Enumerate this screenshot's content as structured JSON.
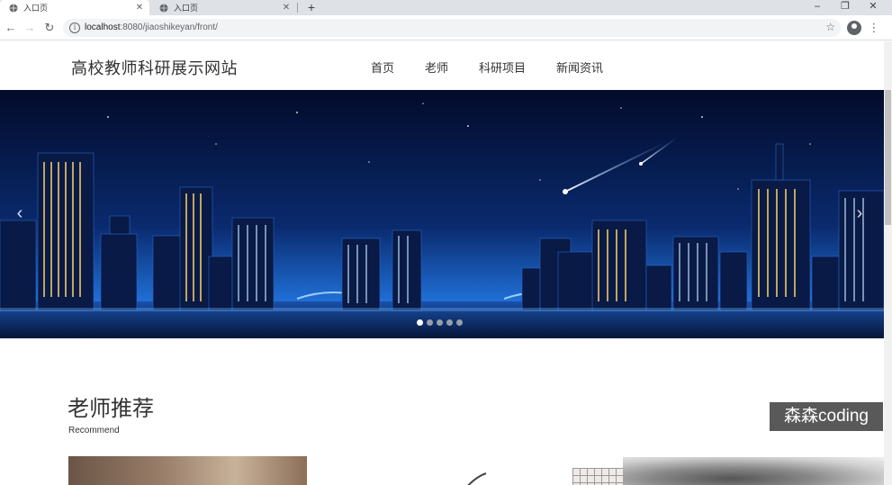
{
  "browser": {
    "tabs": [
      {
        "title": "入口页",
        "active": true
      },
      {
        "title": "入口页",
        "active": false
      }
    ],
    "new_tab_label": "+",
    "url_host": "localhost",
    "url_rest": ":8080/jiaoshikeyan/front/",
    "window_controls": [
      "–",
      "❐",
      "✕"
    ]
  },
  "site": {
    "brand": "高校教师科研展示网站",
    "nav": [
      "首页",
      "老师",
      "科研项目",
      "新闻资讯"
    ]
  },
  "carousel": {
    "prev_arrow": "‹",
    "next_arrow": "›",
    "slide_count": 5,
    "active_slide": 1
  },
  "recommend": {
    "title": "老师推荐",
    "subtitle": "Recommend"
  },
  "watermark": "森森coding",
  "colors": {
    "sky_top": "#020b2a",
    "sky_mid": "#0a2a6e",
    "sky_glow": "#1f6fd6"
  }
}
